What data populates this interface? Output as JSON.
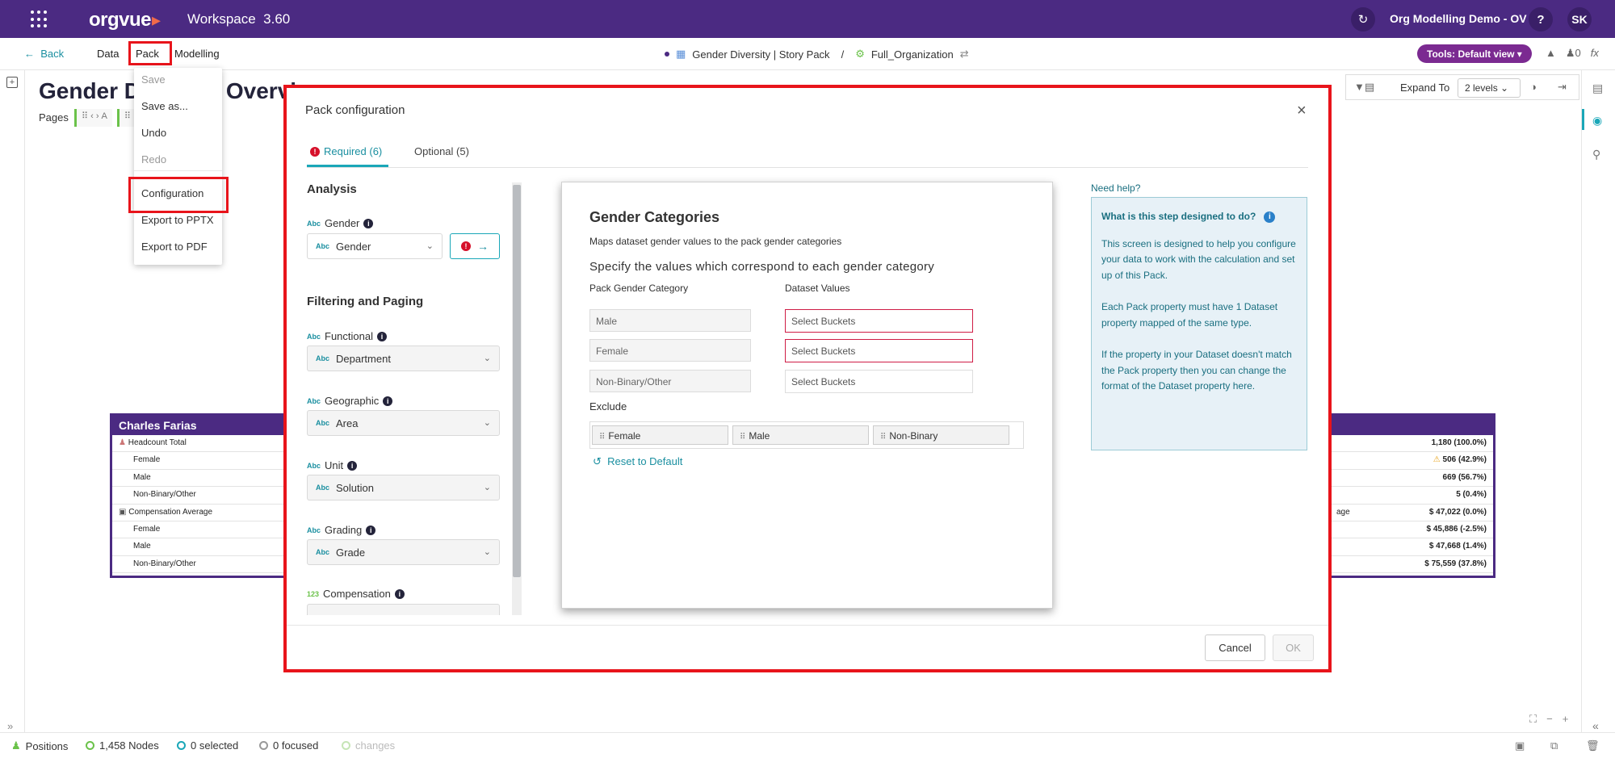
{
  "topbar": {
    "logo": "orgvue",
    "workspace_label": "Workspace",
    "version": "3.60",
    "project": "Org Modelling Demo - OV",
    "help": "?",
    "avatar": "SK"
  },
  "nav": {
    "back": "Back",
    "menu": [
      "Data",
      "Pack",
      "Modelling"
    ],
    "breadcrumb": {
      "pack": "Gender Diversity | Story Pack",
      "separator": "/",
      "dataset": "Full_Organization"
    },
    "tools": "Tools: Default view",
    "pin_count": "0",
    "fx": "fx"
  },
  "pack_menu": {
    "items": [
      "Save",
      "Save as...",
      "Undo",
      "Redo",
      "Configuration",
      "Export to PPTX",
      "Export to PDF"
    ],
    "disabled": [
      "Save",
      "Redo"
    ]
  },
  "background": {
    "title": "Gender Diversity Overview",
    "pages_label": "Pages",
    "expand_label": "Expand To",
    "expand_value": "2 levels",
    "card_left": {
      "name": "Charles Farias",
      "rows": [
        "Headcount Total",
        "Female",
        "Male",
        "Non-Binary/Other",
        "Compensation Average",
        "Female",
        "Male",
        "Non-Binary/Other"
      ]
    },
    "card_right": {
      "partial_label": "age",
      "rows": [
        "1,180 (100.0%)",
        "506 (42.9%)",
        "669 (56.7%)",
        "5 (0.4%)",
        "$ 47,022 (0.0%)",
        "$ 45,886 (-2.5%)",
        "$ 47,668 (1.4%)",
        "$ 75,559 (37.8%)"
      ]
    }
  },
  "modal": {
    "title": "Pack configuration",
    "close": "×",
    "tabs": {
      "required": "Required (6)",
      "optional": "Optional (5)"
    },
    "analysis": {
      "heading": "Analysis",
      "gender_label": "Gender",
      "gender_value": "Gender"
    },
    "filtering": {
      "heading": "Filtering and Paging",
      "fields": [
        {
          "type": "Abc",
          "label": "Functional",
          "value": "Department"
        },
        {
          "type": "Abc",
          "label": "Geographic",
          "value": "Area"
        },
        {
          "type": "Abc",
          "label": "Unit",
          "value": "Solution"
        },
        {
          "type": "Abc",
          "label": "Grading",
          "value": "Grade"
        },
        {
          "type": "123",
          "label": "Compensation",
          "value": ""
        }
      ]
    },
    "categories": {
      "title": "Gender Categories",
      "subtitle": "Maps dataset gender values to the pack gender categories",
      "instruction": "Specify the values which correspond to each gender category",
      "col_pack": "Pack Gender Category",
      "col_dataset": "Dataset Values",
      "rows": [
        {
          "category": "Male",
          "placeholder": "Select Buckets",
          "error": true
        },
        {
          "category": "Female",
          "placeholder": "Select Buckets",
          "error": true
        },
        {
          "category": "Non-Binary/Other",
          "placeholder": "Select Buckets",
          "error": false
        }
      ],
      "exclude_label": "Exclude",
      "exclude_chips": [
        "Female",
        "Male",
        "Non-Binary"
      ],
      "reset": "Reset to Default"
    },
    "help": {
      "heading": "Need help?",
      "question": "What is this step designed to do?",
      "paragraphs": [
        "This screen is designed to help you configure your data to work with the calculation and set up of this Pack.",
        "Each Pack property must have 1 Dataset property mapped of the same type.",
        "If the property in your Dataset doesn't match the Pack property then you can change the format of the Dataset property here."
      ]
    },
    "buttons": {
      "cancel": "Cancel",
      "ok": "OK"
    }
  },
  "status": {
    "positions": "Positions",
    "nodes": "1,458 Nodes",
    "selected": "0 selected",
    "focused": "0 focused",
    "changes": "changes"
  },
  "colors": {
    "brand": "#4b2a82",
    "accent": "#1aa7b8",
    "error": "#d6102a",
    "highlight": "#e8141b"
  }
}
